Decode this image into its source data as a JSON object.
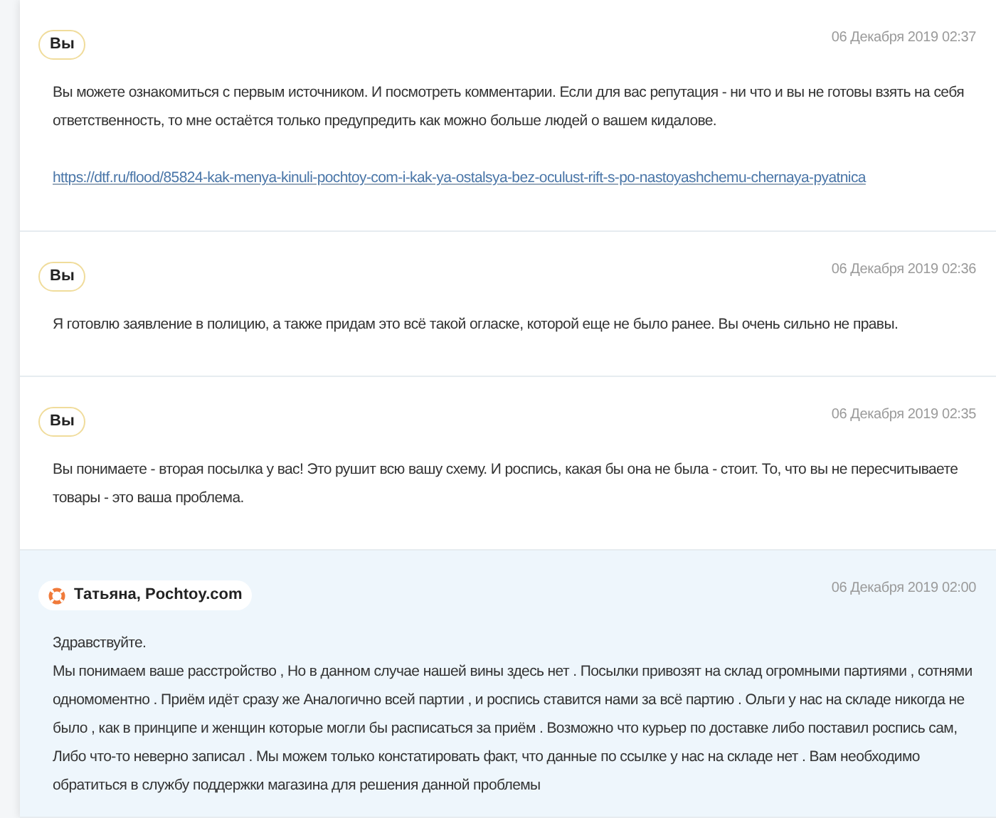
{
  "messages": [
    {
      "kind": "user",
      "author": "Вы",
      "date": "06 Декабря 2019 02:37",
      "paragraphs": [
        "Вы можете ознакомиться с первым источником. И посмотреть комментарии. Если для вас репутация - ни что и вы не готовы взять на себя ответственность, то мне остаётся только предупредить как можно больше людей о вашем кидалове."
      ],
      "link": "https://dtf.ru/flood/85824-kak-menya-kinuli-pochtoy-com-i-kak-ya-ostalsya-bez-oculust-rift-s-po-nastoyashchemu-chernaya-pyatnica"
    },
    {
      "kind": "user",
      "author": "Вы",
      "date": "06 Декабря 2019 02:36",
      "paragraphs": [
        "Я готовлю заявление в полицию, а также придам это всё такой огласке, которой еще не было ранее. Вы очень сильно не правы."
      ]
    },
    {
      "kind": "user",
      "author": "Вы",
      "date": "06 Декабря 2019 02:35",
      "paragraphs": [
        "Вы понимаете - вторая посылка у вас! Это рушит всю вашу схему. И роспись, какая бы она не была - стоит. То, что вы не пересчитываете товары - это ваша проблема."
      ]
    },
    {
      "kind": "support",
      "author": "Татьяна, Pochtoy.com",
      "date": "06 Декабря 2019 02:00",
      "paragraphs": [
        "Здравствуйте.",
        "Мы понимаем ваше расстройство , Но в данном случае нашей вины здесь нет . Посылки привозят на склад огромными партиями , сотнями одномоментно . Приём идёт сразу же Аналогично всей партии , и роспись ставится нами за всё партию . Ольги у нас на складе никогда не было , как в принципе и женщин которые могли бы расписаться за приём . Возможно что курьер по доставке либо поставил роспись сам, Либо что-то неверно записал . Мы можем только констатировать факт, что данные по ссылке у нас на складе нет . Вам необходимо обратиться в службу поддержки магазина для решения данной проблемы"
      ]
    }
  ]
}
